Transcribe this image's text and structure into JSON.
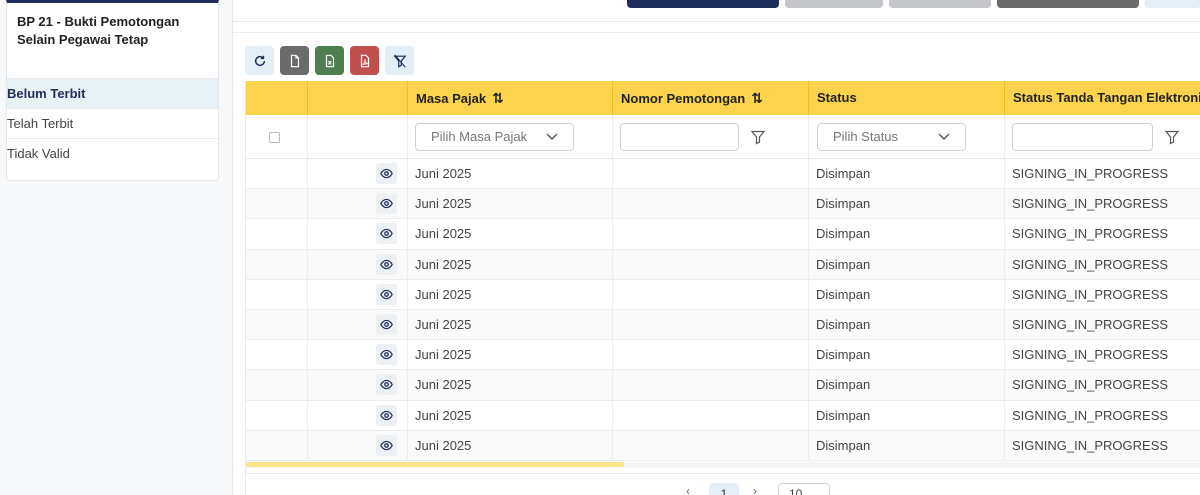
{
  "sidebar": {
    "title": "BP 21 - Bukti Pemotongan Selain Pegawai Tetap",
    "items": [
      {
        "label": "Belum Terbit",
        "active": true
      },
      {
        "label": "Telah Terbit",
        "active": false
      },
      {
        "label": "Tidak Valid",
        "active": false
      }
    ]
  },
  "colors": {
    "header_yellow": "#fcd34d",
    "primary_navy": "#1f2d5c",
    "excel_green": "#4f7f4f",
    "pdf_red": "#c0504d",
    "gray": "#6b6b6b"
  },
  "toolbar": {
    "buttons": [
      {
        "icon": "refresh-icon"
      },
      {
        "icon": "file-icon"
      },
      {
        "icon": "excel-file-icon"
      },
      {
        "icon": "pdf-file-icon"
      },
      {
        "icon": "filter-clear-icon"
      }
    ]
  },
  "table": {
    "columns": [
      {
        "label": "Masa Pajak",
        "sortable": true
      },
      {
        "label": "Nomor Pemotongan",
        "sortable": true
      },
      {
        "label": "Status",
        "sortable": false
      },
      {
        "label": "Status Tanda Tangan Elektronik",
        "sortable": false
      }
    ],
    "filters": {
      "masa_pajak_placeholder": "Pilih Masa Pajak",
      "nomor_value": "",
      "status_placeholder": "Pilih Status",
      "ttd_value": ""
    },
    "rows": [
      {
        "masa": "Juni 2025",
        "nomor": "",
        "status": "Disimpan",
        "ttd": "SIGNING_IN_PROGRESS"
      },
      {
        "masa": "Juni 2025",
        "nomor": "",
        "status": "Disimpan",
        "ttd": "SIGNING_IN_PROGRESS"
      },
      {
        "masa": "Juni 2025",
        "nomor": "",
        "status": "Disimpan",
        "ttd": "SIGNING_IN_PROGRESS"
      },
      {
        "masa": "Juni 2025",
        "nomor": "",
        "status": "Disimpan",
        "ttd": "SIGNING_IN_PROGRESS"
      },
      {
        "masa": "Juni 2025",
        "nomor": "",
        "status": "Disimpan",
        "ttd": "SIGNING_IN_PROGRESS"
      },
      {
        "masa": "Juni 2025",
        "nomor": "",
        "status": "Disimpan",
        "ttd": "SIGNING_IN_PROGRESS"
      },
      {
        "masa": "Juni 2025",
        "nomor": "",
        "status": "Disimpan",
        "ttd": "SIGNING_IN_PROGRESS"
      },
      {
        "masa": "Juni 2025",
        "nomor": "",
        "status": "Disimpan",
        "ttd": "SIGNING_IN_PROGRESS"
      },
      {
        "masa": "Juni 2025",
        "nomor": "",
        "status": "Disimpan",
        "ttd": "SIGNING_IN_PROGRESS"
      },
      {
        "masa": "Juni 2025",
        "nomor": "",
        "status": "Disimpan",
        "ttd": "SIGNING_IN_PROGRESS"
      }
    ]
  },
  "pager": {
    "prev": "‹",
    "current": "1",
    "next": "›",
    "page_size": "10"
  }
}
